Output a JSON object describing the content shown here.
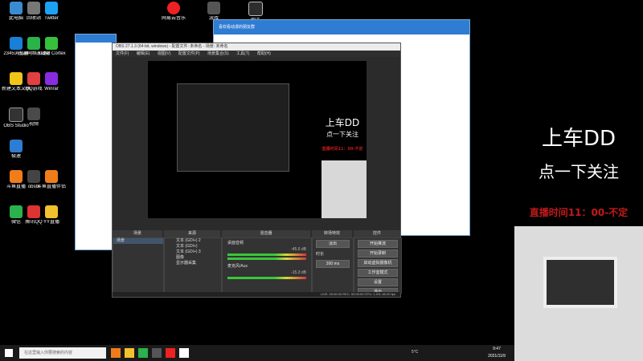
{
  "desktop_icons": [
    {
      "label": "此电脑"
    },
    {
      "label": "回收站"
    },
    {
      "label": "Twitter"
    },
    {
      "label": "2345浏览器"
    },
    {
      "label": "迅游网络加速器"
    },
    {
      "label": "Razer Cortex"
    },
    {
      "label": "新建文本文档"
    },
    {
      "label": "QQ游戏"
    },
    {
      "label": "Winrar"
    },
    {
      "label": "OBS Studio"
    },
    {
      "label": "视频"
    },
    {
      "label": "极速"
    },
    {
      "label": "斗鱼直播"
    },
    {
      "label": "obsbl"
    },
    {
      "label": "斗鱼直播伴侣"
    },
    {
      "label": "微信"
    },
    {
      "label": "腾讯QQ"
    },
    {
      "label": "YY直播"
    }
  ],
  "top_icons": [
    {
      "label": "网易云音乐"
    },
    {
      "label": "游戏"
    },
    {
      "label": "助手"
    }
  ],
  "qq_window": {
    "title": "喜欢看动漫的朋友群"
  },
  "obs": {
    "title": "OBS 27.1.3 (64-bit, windows) - 配置文件: 未命名 - 场景: 未命名",
    "menu": [
      "文件(F)",
      "编辑(E)",
      "视图(V)",
      "配置文件(P)",
      "场景集合(S)",
      "工具(T)",
      "帮助(H)"
    ],
    "preview_title": "上车DD",
    "preview_subtitle": "点一下关注",
    "preview_red": "直播时间11：00-不定",
    "docks": {
      "scenes_title": "场景",
      "sources_title": "来源",
      "mixer_title": "混音器",
      "transitions_title": "转场特效",
      "controls_title": "控件"
    },
    "scene_items": [
      "场景"
    ],
    "source_items": [
      "文本 (GDI+) 2",
      "文本 (GDI+)",
      "文本 (GDI+) 3",
      "图像",
      "显示器采集"
    ],
    "mixer_tracks": [
      {
        "name": "桌面音频",
        "level": "-45.6 dB"
      },
      {
        "name": "麦克风/Aux",
        "level": "-15.3 dB"
      }
    ],
    "transition": {
      "type": "淡出",
      "duration_label": "时长",
      "duration_value": "300 ms"
    },
    "controls": [
      "开始推流",
      "开始录制",
      "启动虚拟摄像机",
      "工作室模式",
      "设置",
      "退出"
    ],
    "status": "LIVE: 00:00:00   REC: 00:00:00   CPU: 1.4%, 60.00 fps"
  },
  "taskbar": {
    "search_placeholder": "在这里输入你要搜索的内容",
    "weather": "5°C",
    "time": "9:47",
    "date": "2021/11/9"
  },
  "overlay": {
    "title": "上车DD",
    "subtitle": "点一下关注",
    "schedule": "直播时间11：00-不定"
  },
  "colors": {
    "obs_dark": "#2b2b2b",
    "qq_blue": "#2f7cd3",
    "accent_red": "#c21a1a"
  }
}
